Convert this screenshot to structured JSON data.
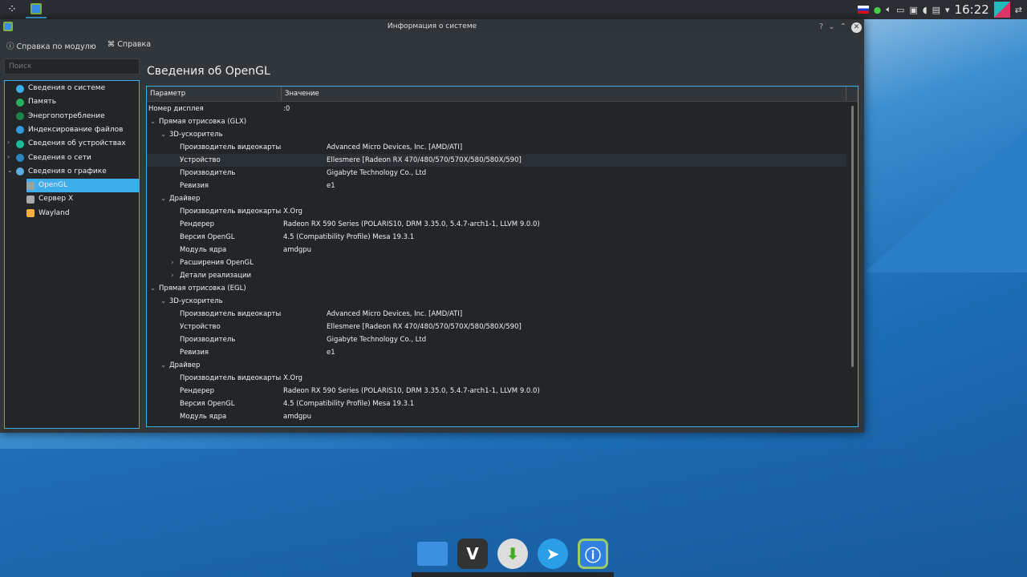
{
  "window": {
    "title": "Информация о системе"
  },
  "toolbar": {
    "module_help": "Справка по модулю",
    "help": "Справка"
  },
  "search": {
    "placeholder": "Поиск"
  },
  "sidebar": {
    "items": [
      {
        "label": "Сведения о системе",
        "color": "#3daee9"
      },
      {
        "label": "Память",
        "color": "#27ae60"
      },
      {
        "label": "Энергопотребление",
        "color": "#1e8449"
      },
      {
        "label": "Индексирование файлов",
        "color": "#3498db"
      },
      {
        "label": "Сведения об устройствах",
        "color": "#1abc9c"
      },
      {
        "label": "Сведения о сети",
        "color": "#2e86c1"
      },
      {
        "label": "Сведения о графике",
        "color": "#5dade2"
      },
      {
        "label": "OpenGL",
        "color": "#95a5a6"
      },
      {
        "label": "Сервер X",
        "color": "#aaaaaa"
      },
      {
        "label": "Wayland",
        "color": "#f5b041"
      }
    ]
  },
  "page": {
    "title": "Сведения об OpenGL"
  },
  "table": {
    "headers": [
      "Параметр",
      "Значение"
    ],
    "rows": [
      {
        "k": "Номер дисплея",
        "v": ":0",
        "lvl": 0
      },
      {
        "k": "Прямая отрисовка (GLX)",
        "v": "",
        "lvl": 0,
        "exp": "open"
      },
      {
        "k": "3D-ускоритель",
        "v": "",
        "lvl": 1,
        "exp": "open"
      },
      {
        "k": "Производитель видеокарты",
        "v": "Advanced Micro Devices, Inc. [AMD/ATI]",
        "lvl": 2,
        "wide": true
      },
      {
        "k": "Устройство",
        "v": "Ellesmere [Radeon RX 470/480/570/570X/580/580X/590]",
        "lvl": 2,
        "wide": true
      },
      {
        "k": "Производитель",
        "v": "Gigabyte Technology Co., Ltd",
        "lvl": 2,
        "wide": true
      },
      {
        "k": "Ревизия",
        "v": "e1",
        "lvl": 2,
        "wide": true
      },
      {
        "k": "Драйвер",
        "v": "",
        "lvl": 1,
        "exp": "open"
      },
      {
        "k": "Производитель видеокарты",
        "v": "X.Org",
        "lvl": 2
      },
      {
        "k": "Рендерер",
        "v": "Radeon RX 590 Series (POLARIS10, DRM 3.35.0, 5.4.7-arch1-1, LLVM 9.0.0)",
        "lvl": 2
      },
      {
        "k": "Версия OpenGL",
        "v": "4.5 (Compatibility Profile) Mesa 19.3.1",
        "lvl": 2
      },
      {
        "k": "Модуль ядра",
        "v": "amdgpu",
        "lvl": 2
      },
      {
        "k": "Расширения OpenGL",
        "v": "",
        "lvl": 2,
        "exp": "closed"
      },
      {
        "k": "Детали реализации",
        "v": "",
        "lvl": 2,
        "exp": "closed"
      },
      {
        "k": "Прямая отрисовка (EGL)",
        "v": "",
        "lvl": 0,
        "exp": "open"
      },
      {
        "k": "3D-ускоритель",
        "v": "",
        "lvl": 1,
        "exp": "open"
      },
      {
        "k": "Производитель видеокарты",
        "v": "Advanced Micro Devices, Inc. [AMD/ATI]",
        "lvl": 2,
        "wide": true
      },
      {
        "k": "Устройство",
        "v": "Ellesmere [Radeon RX 470/480/570/570X/580/580X/590]",
        "lvl": 2,
        "wide": true
      },
      {
        "k": "Производитель",
        "v": "Gigabyte Technology Co., Ltd",
        "lvl": 2,
        "wide": true
      },
      {
        "k": "Ревизия",
        "v": "e1",
        "lvl": 2,
        "wide": true
      },
      {
        "k": "Драйвер",
        "v": "",
        "lvl": 1,
        "exp": "open"
      },
      {
        "k": "Производитель видеокарты",
        "v": "X.Org",
        "lvl": 2
      },
      {
        "k": "Рендерер",
        "v": "Radeon RX 590 Series (POLARIS10, DRM 3.35.0, 5.4.7-arch1-1, LLVM 9.0.0)",
        "lvl": 2
      },
      {
        "k": "Версия OpenGL",
        "v": "4.5 (Compatibility Profile) Mesa 19.3.1",
        "lvl": 2
      },
      {
        "k": "Модуль ядра",
        "v": "amdgpu",
        "lvl": 2
      }
    ]
  },
  "panel": {
    "clock": "16:22"
  }
}
